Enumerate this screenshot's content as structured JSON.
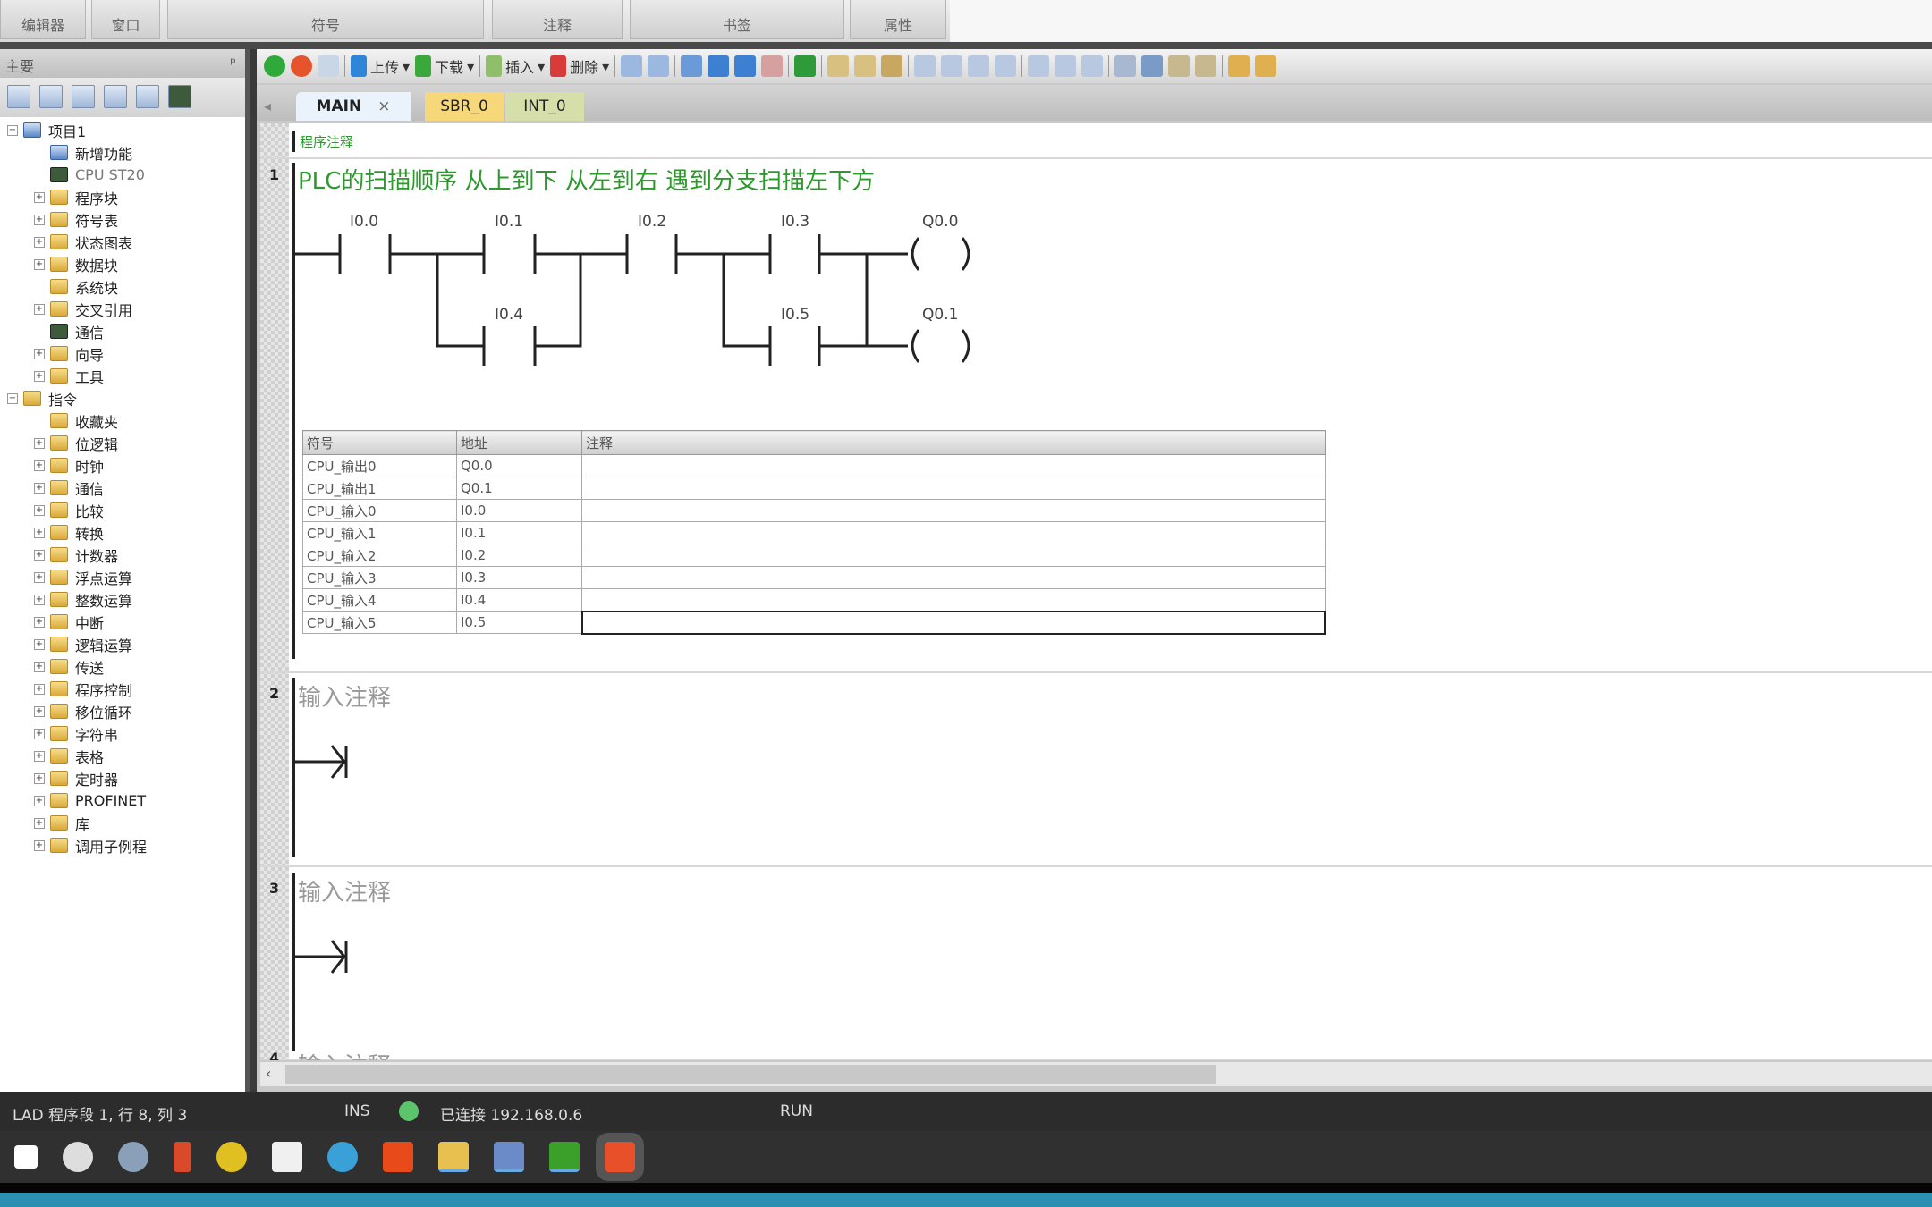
{
  "ribbon": {
    "groups": [
      "编辑器",
      "窗口",
      "符号",
      "注释",
      "书签",
      "属性"
    ]
  },
  "left_panel": {
    "title": "主要",
    "pin": "ᵖ",
    "tree": [
      {
        "label": "项目1",
        "level": 0,
        "exp": "−",
        "icon": "project"
      },
      {
        "label": "新增功能",
        "level": 1,
        "exp": "",
        "icon": "new"
      },
      {
        "label": "CPU ST20",
        "level": 1,
        "exp": "",
        "icon": "cpu"
      },
      {
        "label": "程序块",
        "level": 1,
        "exp": "+",
        "icon": "folder"
      },
      {
        "label": "符号表",
        "level": 1,
        "exp": "+",
        "icon": "folder"
      },
      {
        "label": "状态图表",
        "level": 1,
        "exp": "+",
        "icon": "folder"
      },
      {
        "label": "数据块",
        "level": 1,
        "exp": "+",
        "icon": "folder"
      },
      {
        "label": "系统块",
        "level": 1,
        "exp": "",
        "icon": "folder"
      },
      {
        "label": "交叉引用",
        "level": 1,
        "exp": "+",
        "icon": "folder"
      },
      {
        "label": "通信",
        "level": 1,
        "exp": "",
        "icon": "monitor"
      },
      {
        "label": "向导",
        "level": 1,
        "exp": "+",
        "icon": "folder"
      },
      {
        "label": "工具",
        "level": 1,
        "exp": "+",
        "icon": "folder"
      },
      {
        "label": "指令",
        "level": 0,
        "exp": "−",
        "icon": "folder"
      },
      {
        "label": "收藏夹",
        "level": 1,
        "exp": "",
        "icon": "folder"
      },
      {
        "label": "位逻辑",
        "level": 1,
        "exp": "+",
        "icon": "folder"
      },
      {
        "label": "时钟",
        "level": 1,
        "exp": "+",
        "icon": "folder"
      },
      {
        "label": "通信",
        "level": 1,
        "exp": "+",
        "icon": "folder"
      },
      {
        "label": "比较",
        "level": 1,
        "exp": "+",
        "icon": "folder"
      },
      {
        "label": "转换",
        "level": 1,
        "exp": "+",
        "icon": "folder"
      },
      {
        "label": "计数器",
        "level": 1,
        "exp": "+",
        "icon": "folder"
      },
      {
        "label": "浮点运算",
        "level": 1,
        "exp": "+",
        "icon": "folder"
      },
      {
        "label": "整数运算",
        "level": 1,
        "exp": "+",
        "icon": "folder"
      },
      {
        "label": "中断",
        "level": 1,
        "exp": "+",
        "icon": "folder"
      },
      {
        "label": "逻辑运算",
        "level": 1,
        "exp": "+",
        "icon": "folder"
      },
      {
        "label": "传送",
        "level": 1,
        "exp": "+",
        "icon": "folder"
      },
      {
        "label": "程序控制",
        "level": 1,
        "exp": "+",
        "icon": "folder"
      },
      {
        "label": "移位循环",
        "level": 1,
        "exp": "+",
        "icon": "folder"
      },
      {
        "label": "字符串",
        "level": 1,
        "exp": "+",
        "icon": "folder"
      },
      {
        "label": "表格",
        "level": 1,
        "exp": "+",
        "icon": "folder"
      },
      {
        "label": "定时器",
        "level": 1,
        "exp": "+",
        "icon": "folder"
      },
      {
        "label": "PROFINET",
        "level": 1,
        "exp": "+",
        "icon": "folder"
      },
      {
        "label": "库",
        "level": 1,
        "exp": "+",
        "icon": "folder"
      },
      {
        "label": "调用子例程",
        "level": 1,
        "exp": "+",
        "icon": "folder"
      }
    ]
  },
  "toolbar": {
    "upload": "上传",
    "download": "下载",
    "insert": "插入",
    "delete": "删除"
  },
  "tabs": [
    {
      "label": "MAIN",
      "close": "×",
      "color": "#eaf2fb"
    },
    {
      "label": "SBR_0",
      "color": "#f6d77a"
    },
    {
      "label": "INT_0",
      "color": "#d6dfaa"
    }
  ],
  "program_comment": "程序注释",
  "networks": [
    {
      "number": "1",
      "title": "PLC的扫描顺序  从上到下 从左到右 遇到分支扫描左下方",
      "title_color": "#2a9a2a",
      "contacts": [
        "I0.0",
        "I0.1",
        "I0.2",
        "I0.3",
        "I0.4",
        "I0.5"
      ],
      "coils": [
        "Q0.0",
        "Q0.1"
      ]
    },
    {
      "number": "2",
      "title": "输入注释",
      "title_color": "#999999"
    },
    {
      "number": "3",
      "title": "输入注释",
      "title_color": "#999999"
    },
    {
      "number": "4",
      "title": "输入注释",
      "title_color": "#999999"
    }
  ],
  "symbol_table": {
    "headers": [
      "符号",
      "地址",
      "注释"
    ],
    "rows": [
      [
        "CPU_输出0",
        "Q0.0",
        ""
      ],
      [
        "CPU_输出1",
        "Q0.1",
        ""
      ],
      [
        "CPU_输入0",
        "I0.0",
        ""
      ],
      [
        "CPU_输入1",
        "I0.1",
        ""
      ],
      [
        "CPU_输入2",
        "I0.2",
        ""
      ],
      [
        "CPU_输入3",
        "I0.3",
        ""
      ],
      [
        "CPU_输入4",
        "I0.4",
        ""
      ],
      [
        "CPU_输入5",
        "I0.5",
        ""
      ]
    ]
  },
  "status": {
    "position": "LAD 程序段 1, 行 8, 列 3",
    "mode": "INS",
    "connection": "已连接 192.168.0.6",
    "cpu_state": "RUN",
    "led_color": "#5cc46a"
  },
  "taskbar": {
    "apps": [
      "start",
      "app-ss",
      "app-1",
      "app-2",
      "app-3",
      "app-4",
      "app-video",
      "app-jf",
      "file-explorer",
      "app-5",
      "camtasia-green",
      "camtasia-red"
    ]
  }
}
